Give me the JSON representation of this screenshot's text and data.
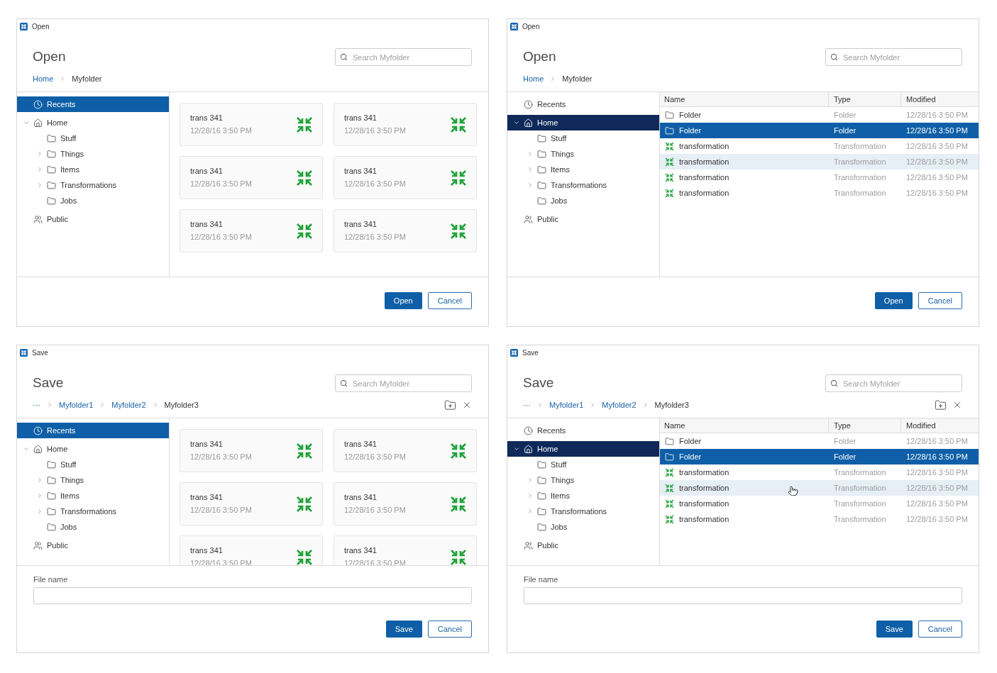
{
  "dialogs": [
    {
      "kind": "open",
      "window_title": "Open",
      "heading": "Open",
      "search": {
        "placeholder": "Search Myfolder"
      },
      "breadcrumb": [
        {
          "label": "Home",
          "link": true
        },
        {
          "label": "Myfolder",
          "link": false
        }
      ],
      "sidebar": {
        "focused": false,
        "items": [
          {
            "kind": "recents",
            "label": "Recents",
            "selected": true
          },
          {
            "kind": "home",
            "label": "Home",
            "selected": false,
            "expanded": true,
            "children": [
              {
                "kind": "folder",
                "label": "Stuff",
                "selected": false
              },
              {
                "kind": "folder",
                "label": "Things",
                "selected": false,
                "expanded": false
              },
              {
                "kind": "folder",
                "label": "Items",
                "selected": false,
                "expanded": false
              },
              {
                "kind": "folder",
                "label": "Transformations",
                "selected": false,
                "expanded": false
              },
              {
                "kind": "folder",
                "label": "Jobs",
                "selected": false
              }
            ]
          },
          {
            "kind": "public",
            "label": "Public",
            "selected": false
          }
        ]
      },
      "view": {
        "kind": "cards",
        "cards": [
          {
            "title": "trans 341",
            "date": "12/28/16 3:50 PM"
          },
          {
            "title": "trans 341",
            "date": "12/28/16 3:50 PM"
          },
          {
            "title": "trans 341",
            "date": "12/28/16 3:50 PM"
          },
          {
            "title": "trans 341",
            "date": "12/28/16 3:50 PM"
          },
          {
            "title": "trans 341",
            "date": "12/28/16 3:50 PM"
          },
          {
            "title": "trans 341",
            "date": "12/28/16 3:50 PM"
          }
        ]
      },
      "buttons": [
        {
          "label": "Open",
          "primary": true
        },
        {
          "label": "Cancel",
          "primary": false
        }
      ]
    },
    {
      "kind": "open",
      "window_title": "Open",
      "heading": "Open",
      "search": {
        "placeholder": "Search Myfolder"
      },
      "breadcrumb": [
        {
          "label": "Home",
          "link": true
        },
        {
          "label": "Myfolder",
          "link": false
        }
      ],
      "sidebar": {
        "focused": true,
        "items": [
          {
            "kind": "recents",
            "label": "Recents",
            "selected": false
          },
          {
            "kind": "home",
            "label": "Home",
            "selected": true,
            "expanded": true,
            "children": [
              {
                "kind": "folder",
                "label": "Stuff",
                "selected": false
              },
              {
                "kind": "folder",
                "label": "Things",
                "selected": false,
                "expanded": false
              },
              {
                "kind": "folder",
                "label": "Items",
                "selected": false,
                "expanded": false
              },
              {
                "kind": "folder",
                "label": "Transformations",
                "selected": false,
                "expanded": false
              },
              {
                "kind": "folder",
                "label": "Jobs",
                "selected": false
              }
            ]
          },
          {
            "kind": "public",
            "label": "Public",
            "selected": false
          }
        ]
      },
      "view": {
        "kind": "table",
        "columns": [
          "Name",
          "Type",
          "Modified"
        ],
        "rows": [
          {
            "kind": "folder",
            "name": "Folder",
            "type": "Folder",
            "modified": "12/28/16 3:50 PM",
            "selected": false,
            "hovered": false,
            "pointer": false
          },
          {
            "kind": "folder",
            "name": "Folder",
            "type": "Folder",
            "modified": "12/28/16 3:50 PM",
            "selected": true,
            "hovered": false,
            "pointer": false
          },
          {
            "kind": "transformation",
            "name": "transformation",
            "type": "Transformation",
            "modified": "12/28/16 3:50 PM",
            "selected": false,
            "hovered": false,
            "pointer": false
          },
          {
            "kind": "transformation",
            "name": "transformation",
            "type": "Transformation",
            "modified": "12/28/16 3:50 PM",
            "selected": false,
            "hovered": true,
            "pointer": false
          },
          {
            "kind": "transformation",
            "name": "transformation",
            "type": "Transformation",
            "modified": "12/28/16 3:50 PM",
            "selected": false,
            "hovered": false,
            "pointer": false
          },
          {
            "kind": "transformation",
            "name": "transformation",
            "type": "Transformation",
            "modified": "12/28/16 3:50 PM",
            "selected": false,
            "hovered": false,
            "pointer": false
          }
        ]
      },
      "buttons": [
        {
          "label": "Open",
          "primary": true
        },
        {
          "label": "Cancel",
          "primary": false
        }
      ]
    },
    {
      "kind": "save",
      "window_title": "Save",
      "heading": "Save",
      "search": {
        "placeholder": "Search Myfolder"
      },
      "breadcrumb": [
        {
          "label": "···",
          "link": true
        },
        {
          "label": "Myfolder1",
          "link": true
        },
        {
          "label": "Myfolder2",
          "link": true
        },
        {
          "label": "Myfolder3",
          "link": false
        }
      ],
      "actions": [
        {
          "kind": "new_folder"
        },
        {
          "kind": "close"
        }
      ],
      "sidebar": {
        "focused": false,
        "items": [
          {
            "kind": "recents",
            "label": "Recents",
            "selected": true
          },
          {
            "kind": "home",
            "label": "Home",
            "selected": false,
            "expanded": true,
            "children": [
              {
                "kind": "folder",
                "label": "Stuff",
                "selected": false
              },
              {
                "kind": "folder",
                "label": "Things",
                "selected": false,
                "expanded": false
              },
              {
                "kind": "folder",
                "label": "Items",
                "selected": false,
                "expanded": false
              },
              {
                "kind": "folder",
                "label": "Transformations",
                "selected": false,
                "expanded": false
              },
              {
                "kind": "folder",
                "label": "Jobs",
                "selected": false
              }
            ]
          },
          {
            "kind": "public",
            "label": "Public",
            "selected": false
          }
        ]
      },
      "view": {
        "kind": "cards",
        "cards": [
          {
            "title": "trans 341",
            "date": "12/28/16 3:50 PM"
          },
          {
            "title": "trans 341",
            "date": "12/28/16 3:50 PM"
          },
          {
            "title": "trans 341",
            "date": "12/28/16 3:50 PM"
          },
          {
            "title": "trans 341",
            "date": "12/28/16 3:50 PM"
          },
          {
            "title": "trans 341",
            "date": "12/28/16 3:50 PM"
          },
          {
            "title": "trans 341",
            "date": "12/28/16 3:50 PM"
          }
        ]
      },
      "file_name": {
        "label": "File name"
      },
      "buttons": [
        {
          "label": "Save",
          "primary": true
        },
        {
          "label": "Cancel",
          "primary": false
        }
      ]
    },
    {
      "kind": "save",
      "window_title": "Save",
      "heading": "Save",
      "search": {
        "placeholder": "Search Myfolder"
      },
      "breadcrumb": [
        {
          "label": "···",
          "link": true
        },
        {
          "label": "Myfolder1",
          "link": true
        },
        {
          "label": "Myfolder2",
          "link": true
        },
        {
          "label": "Myfolder3",
          "link": false
        }
      ],
      "actions": [
        {
          "kind": "new_folder"
        },
        {
          "kind": "close"
        }
      ],
      "sidebar": {
        "focused": true,
        "items": [
          {
            "kind": "recents",
            "label": "Recents",
            "selected": false
          },
          {
            "kind": "home",
            "label": "Home",
            "selected": true,
            "expanded": true,
            "children": [
              {
                "kind": "folder",
                "label": "Stuff",
                "selected": false
              },
              {
                "kind": "folder",
                "label": "Things",
                "selected": false,
                "expanded": false
              },
              {
                "kind": "folder",
                "label": "Items",
                "selected": false,
                "expanded": false
              },
              {
                "kind": "folder",
                "label": "Transformations",
                "selected": false,
                "expanded": false
              },
              {
                "kind": "folder",
                "label": "Jobs",
                "selected": false
              }
            ]
          },
          {
            "kind": "public",
            "label": "Public",
            "selected": false
          }
        ]
      },
      "view": {
        "kind": "table",
        "columns": [
          "Name",
          "Type",
          "Modified"
        ],
        "rows": [
          {
            "kind": "folder",
            "name": "Folder",
            "type": "Folder",
            "modified": "12/28/16 3:50 PM",
            "selected": false,
            "hovered": false,
            "pointer": false
          },
          {
            "kind": "folder",
            "name": "Folder",
            "type": "Folder",
            "modified": "12/28/16 3:50 PM",
            "selected": true,
            "hovered": false,
            "pointer": false
          },
          {
            "kind": "transformation",
            "name": "transformation",
            "type": "Transformation",
            "modified": "12/28/16 3:50 PM",
            "selected": false,
            "hovered": false,
            "pointer": false
          },
          {
            "kind": "transformation",
            "name": "transformation",
            "type": "Transformation",
            "modified": "12/28/16 3:50 PM",
            "selected": false,
            "hovered": true,
            "pointer": true
          },
          {
            "kind": "transformation",
            "name": "transformation",
            "type": "Transformation",
            "modified": "12/28/16 3:50 PM",
            "selected": false,
            "hovered": false,
            "pointer": false
          },
          {
            "kind": "transformation",
            "name": "transformation",
            "type": "Transformation",
            "modified": "12/28/16 3:50 PM",
            "selected": false,
            "hovered": false,
            "pointer": false
          }
        ]
      },
      "file_name": {
        "label": "File name"
      },
      "buttons": [
        {
          "label": "Save",
          "primary": true
        },
        {
          "label": "Cancel",
          "primary": false
        }
      ]
    }
  ]
}
